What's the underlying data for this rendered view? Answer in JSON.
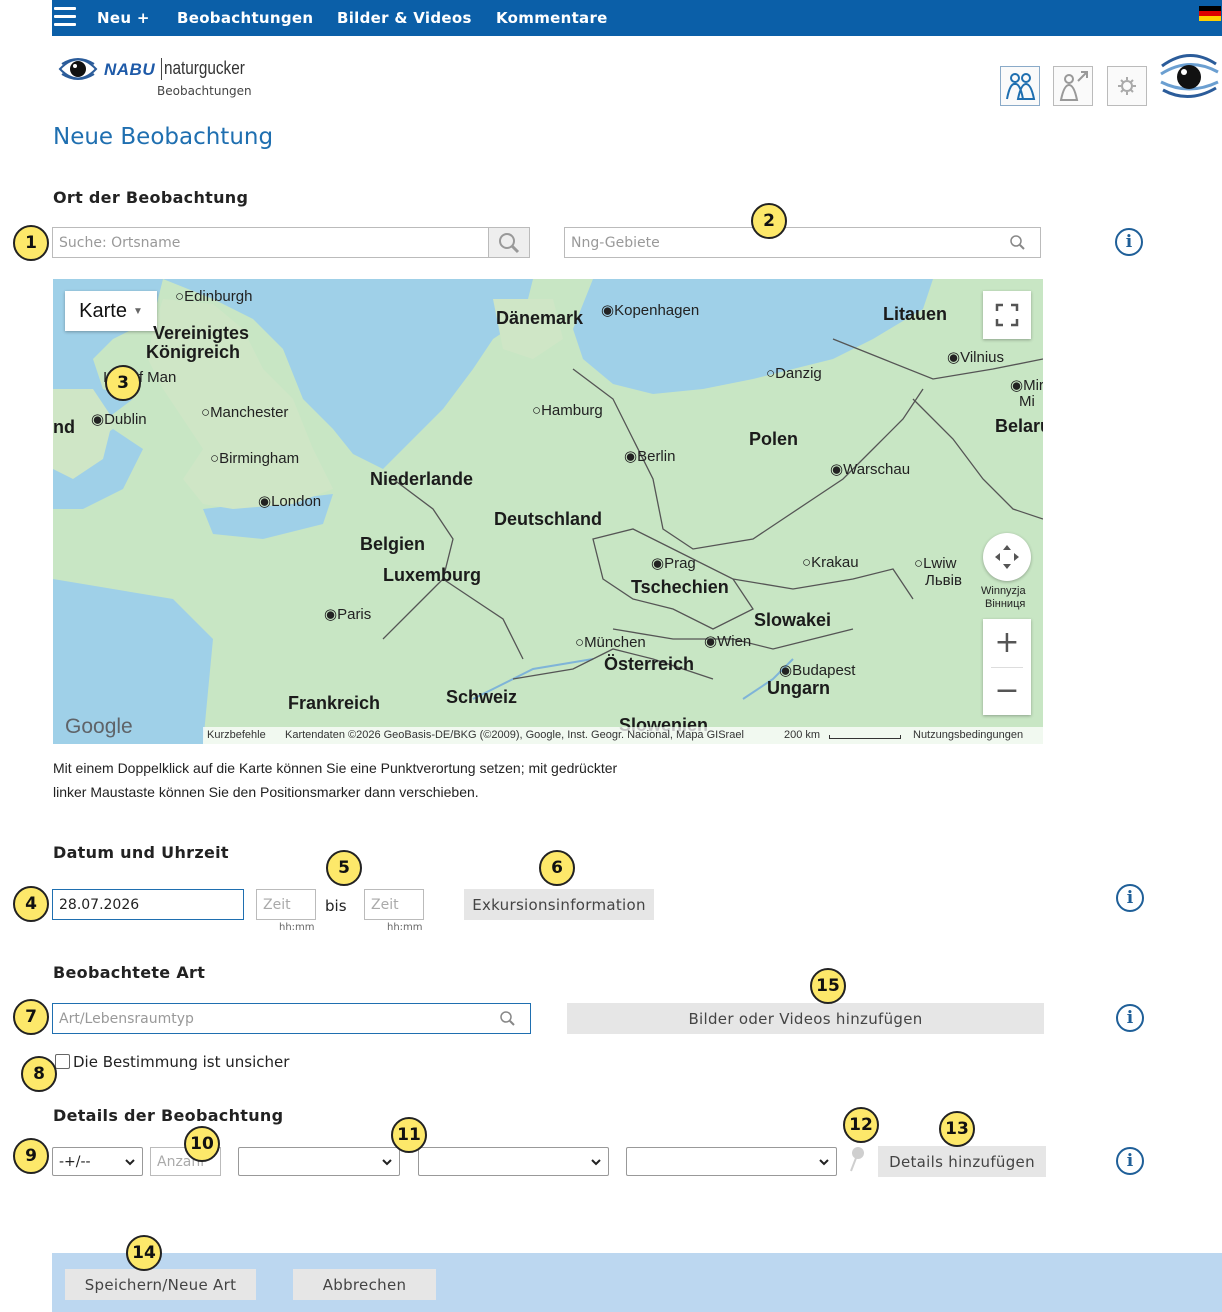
{
  "nav": {
    "items": [
      "Neu +",
      "Beobachtungen",
      "Bilder & Videos",
      "Kommentare"
    ],
    "language_flag": "flag-de-icon"
  },
  "logo": {
    "brand": "NABU",
    "product": "naturgucker",
    "subtitle": "Beobachtungen"
  },
  "page_title": "Neue Beobachtung",
  "location": {
    "heading": "Ort der Beobachtung",
    "search_placeholder": "Suche: Ortsname",
    "area_placeholder": "Nng-Gebiete",
    "map": {
      "type_button": "Karte",
      "countries": [
        "Dänemark",
        "Litauen",
        "Vereinigtes",
        "Königreich",
        "Polen",
        "Niederlande",
        "Deutschland",
        "Belgien",
        "Luxemburg",
        "Tschechien",
        "Slowakei",
        "Österreich",
        "Ungarn",
        "Frankreich",
        "Schweiz",
        "Slowenien",
        "Belaru",
        "nd"
      ],
      "cities": [
        "Edinburgh",
        "Kopenhagen",
        "Vilnius",
        "Danzig",
        "Isle of Man",
        "Dublin",
        "Manchester",
        "Hamburg",
        "Mir",
        "Mi",
        "Birmingham",
        "Berlin",
        "Warschau",
        "London",
        "Prag",
        "Krakau",
        "Lwiw",
        "Львів",
        "Winnyzja",
        "Вінниця",
        "Paris",
        "München",
        "Wien",
        "Budapest"
      ],
      "google": "Google",
      "shortcuts": "Kurzbefehle",
      "attribution": "Kartendaten ©2026 GeoBasis-DE/BKG (©2009), Google, Inst. Geogr. Nacional, Mapa GISrael",
      "scale": "200 km",
      "terms": "Nutzungsbedingungen"
    },
    "hint_line1": "Mit einem Doppelklick auf die Karte können Sie eine Punktverortung setzen; mit gedrückter",
    "hint_line2": "linker Maustaste können Sie den Positionsmarker dann verschieben."
  },
  "datetime": {
    "heading": "Datum und Uhrzeit",
    "date": "28.07.2026",
    "time_from_placeholder": "Zeit",
    "time_to_placeholder": "Zeit",
    "bis": "bis",
    "time_format_from": "hh:mm",
    "time_format_to": "hh:mm",
    "excursion_button": "Exkursionsinformation"
  },
  "species": {
    "heading": "Beobachtete Art",
    "placeholder": "Art/Lebensraumtyp",
    "media_button": "Bilder oder Videos hinzufügen",
    "uncertain_label": "Die Bestimmung ist unsicher"
  },
  "details": {
    "heading": "Details der Beobachtung",
    "qualifier": "-+/--",
    "count_placeholder": "Anzahl",
    "add_button": "Details hinzufügen"
  },
  "footer": {
    "save": "Speichern/Neue Art",
    "cancel": "Abbrechen"
  },
  "annotations": [
    "1",
    "2",
    "3",
    "4",
    "5",
    "6",
    "7",
    "8",
    "9",
    "10",
    "11",
    "12",
    "13",
    "14",
    "15"
  ],
  "colors": {
    "nav_bg": "#0b5fa8",
    "title": "#1f6fb0",
    "badge": "#fde86a",
    "footer_bg": "#bcd7f0",
    "map_land": "#c8e6c4",
    "map_water": "#9fd0e8"
  }
}
